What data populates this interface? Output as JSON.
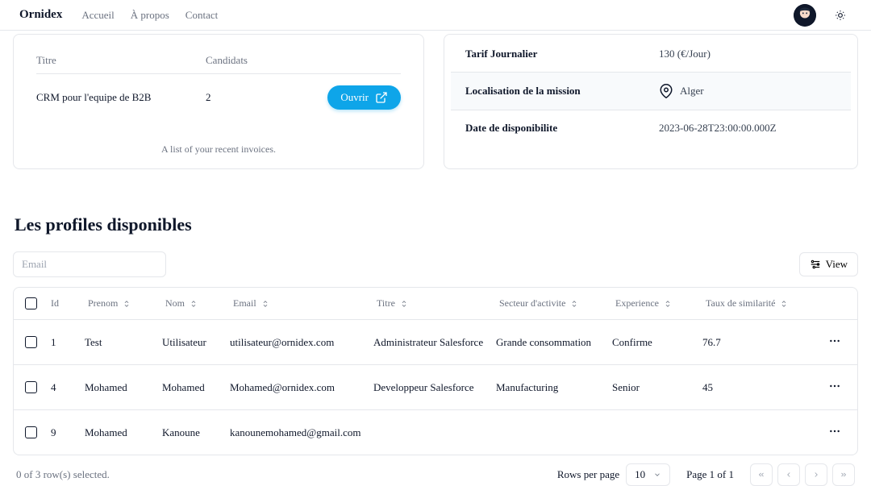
{
  "header": {
    "logo": "Ornidex",
    "nav": {
      "home": "Accueil",
      "about": "À propos",
      "contact": "Contact"
    }
  },
  "invoice_card": {
    "col_title": "Titre",
    "col_candidates": "Candidats",
    "row_title": "CRM pour l'equipe de B2B",
    "row_count": "2",
    "open_label": "Ouvrir",
    "caption": "A list of your recent invoices."
  },
  "info_card": {
    "rate_label": "Tarif Journalier",
    "rate_value": "130 (€/Jour)",
    "location_label": "Localisation de la mission",
    "location_value": "Alger",
    "avail_label": "Date de disponibilite",
    "avail_value": "2023-06-28T23:00:00.000Z"
  },
  "section_title": "Les profiles disponibles",
  "toolbar": {
    "email_placeholder": "Email",
    "view_label": "View"
  },
  "table": {
    "headers": {
      "id": "Id",
      "prenom": "Prenom",
      "nom": "Nom",
      "email": "Email",
      "titre": "Titre",
      "secteur": "Secteur d'activite",
      "exp": "Experience",
      "taux": "Taux de similarité"
    },
    "rows": [
      {
        "id": "1",
        "prenom": "Test",
        "nom": "Utilisateur",
        "email": "utilisateur@ornidex.com",
        "titre": "Administrateur Salesforce",
        "secteur": "Grande consommation",
        "exp": "Confirme",
        "taux": "76.7"
      },
      {
        "id": "4",
        "prenom": "Mohamed",
        "nom": "Mohamed",
        "email": "Mohamed@ornidex.com",
        "titre": "Developpeur Salesforce",
        "secteur": "Manufacturing",
        "exp": "Senior",
        "taux": "45"
      },
      {
        "id": "9",
        "prenom": "Mohamed",
        "nom": "Kanoune",
        "email": "kanounemohamed@gmail.com",
        "titre": "",
        "secteur": "",
        "exp": "",
        "taux": ""
      }
    ]
  },
  "footer": {
    "selected": "0 of 3 row(s) selected.",
    "rpp_label": "Rows per page",
    "rpp_value": "10",
    "page_info": "Page 1 of 1"
  }
}
